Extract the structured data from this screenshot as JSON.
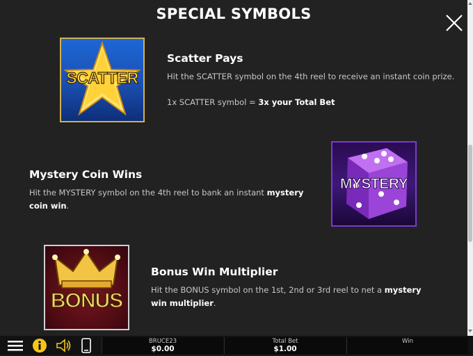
{
  "header": {
    "title": "SPECIAL SYMBOLS"
  },
  "sections": [
    {
      "heading": "Scatter Pays",
      "image_label": "SCATTER",
      "description": "Hit the SCATTER symbol on the 4th reel to receive an instant coin prize.",
      "payout_prefix": "1x SCATTER symbol = ",
      "payout_bold": "3x your Total Bet"
    },
    {
      "heading": "Mystery Coin Wins",
      "image_label": "MYSTERY",
      "description_prefix": "Hit the MYSTERY symbol on the 4th reel to bank an instant ",
      "description_bold": "mystery coin win",
      "description_suffix": "."
    },
    {
      "heading": "Bonus Win Multiplier",
      "image_label": "BONUS",
      "description_prefix": "Hit the BONUS symbol on the 1st, 2nd or 3rd reel to net a ",
      "description_bold": "mystery win multiplier",
      "description_suffix": "."
    }
  ],
  "bottom_bar": {
    "player_label": "BRUCE23",
    "player_value": "$0.00",
    "bet_label": "Total Bet",
    "bet_value": "$1.00",
    "win_label": "Win",
    "win_value": ""
  },
  "colors": {
    "background": "#222222",
    "info_icon": "#f5c518",
    "scatter_gold": "#ffd84a",
    "mystery_purple": "#7b3ad0",
    "bonus_red": "#7a1620"
  },
  "icons": [
    "close-icon",
    "menu-icon",
    "info-icon",
    "sound-icon",
    "mobile-icon",
    "star-icon",
    "dice-icon",
    "crown-icon"
  ]
}
